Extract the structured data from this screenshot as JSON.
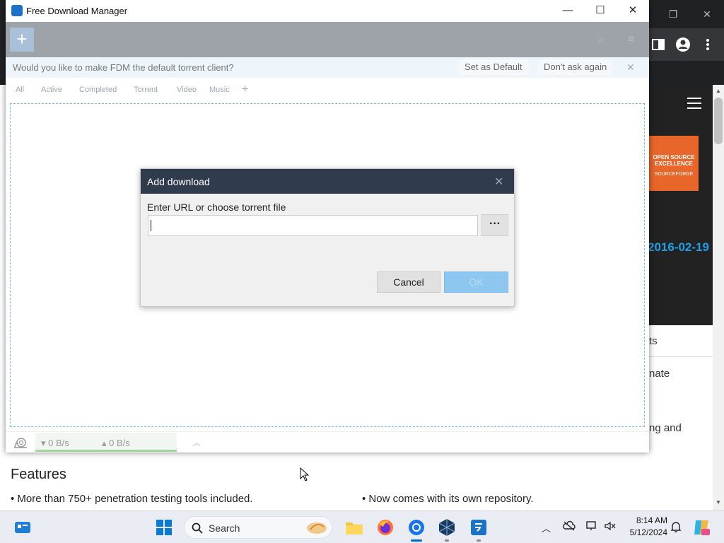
{
  "fdm": {
    "window_title": "Free Download Manager",
    "banner": {
      "question": "Would you like to make FDM the default torrent client?",
      "set_default": "Set as Default",
      "dont_ask": "Don't ask again"
    },
    "tabs": [
      "All",
      "Active",
      "Completed",
      "Torrent",
      "Video",
      "Music"
    ],
    "status": {
      "download_speed": "0 B/s",
      "upload_speed": "0 B/s"
    }
  },
  "dialog": {
    "title": "Add download",
    "label": "Enter URL or choose torrent file",
    "url_value": "",
    "browse": "···",
    "cancel": "Cancel",
    "ok": "OK"
  },
  "webpage": {
    "date": "2016-02-19",
    "badge_line1": "OPEN SOURCE EXCELLENCE",
    "badge_line2": "SOURCEFORGE",
    "fragments": [
      "ts",
      "nate",
      "ng and"
    ],
    "features_title": "Features",
    "feature_1": "More than 750+ penetration testing tools included.",
    "feature_2": "Now comes with its own repository."
  },
  "taskbar": {
    "search_label": "Search",
    "time": "8:14 AM",
    "date": "5/12/2024"
  },
  "colors": {
    "accent": "#0067c0",
    "dialog_header": "#313b4e",
    "ok_disabled": "#8dc6ee",
    "dropzone_border": "#7fc0e8",
    "badge": "#e8662a"
  }
}
